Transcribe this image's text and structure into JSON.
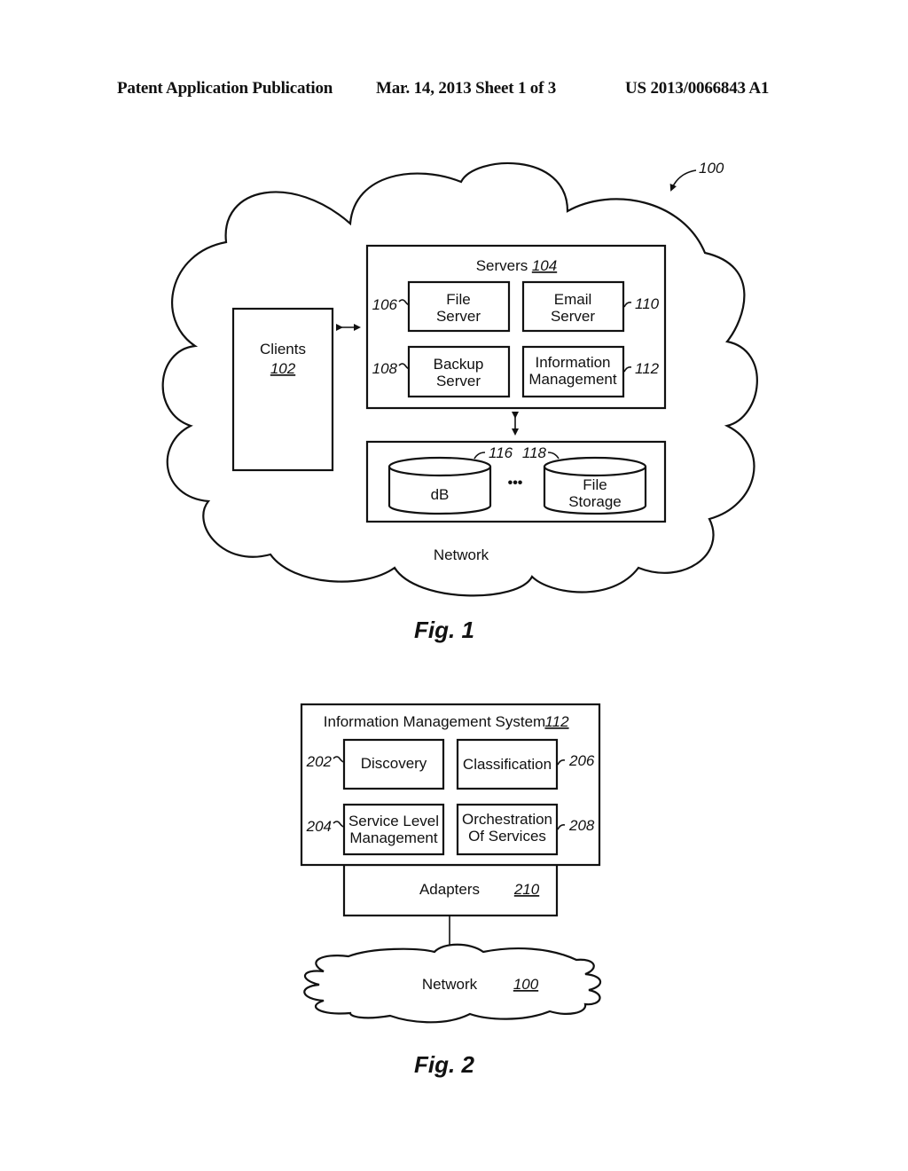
{
  "header": {
    "publication": "Patent Application Publication",
    "date_sheet": "Mar. 14, 2013  Sheet 1 of 3",
    "number": "US 2013/0066843 A1"
  },
  "fig1": {
    "ref_system": "100",
    "network_label": "Network",
    "clients": {
      "label": "Clients",
      "ref": "102"
    },
    "servers": {
      "label": "Servers",
      "ref": "104",
      "items": [
        {
          "line1": "File",
          "line2": "Server",
          "ref": "106"
        },
        {
          "line1": "Email",
          "line2": "Server",
          "ref": "110"
        },
        {
          "line1": "Backup",
          "line2": "Server",
          "ref": "108"
        },
        {
          "line1": "Information",
          "line2": "Management",
          "ref": "112"
        }
      ]
    },
    "storage": {
      "db": {
        "label": "dB",
        "ref": "116"
      },
      "file": {
        "line1": "File",
        "line2": "Storage",
        "ref": "118"
      },
      "ellipsis": "•••"
    },
    "caption": "Fig. 1"
  },
  "fig2": {
    "ims": {
      "label": "Information Management System",
      "ref": "112"
    },
    "modules": [
      {
        "line1": "Discovery",
        "line2": "",
        "ref": "202"
      },
      {
        "line1": "Classification",
        "line2": "",
        "ref": "206"
      },
      {
        "line1": "Service Level",
        "line2": "Management",
        "ref": "204"
      },
      {
        "line1": "Orchestration",
        "line2": "Of Services",
        "ref": "208"
      }
    ],
    "adapters": {
      "label": "Adapters",
      "ref": "210"
    },
    "network": {
      "label": "Network",
      "ref": "100"
    },
    "caption": "Fig. 2"
  }
}
